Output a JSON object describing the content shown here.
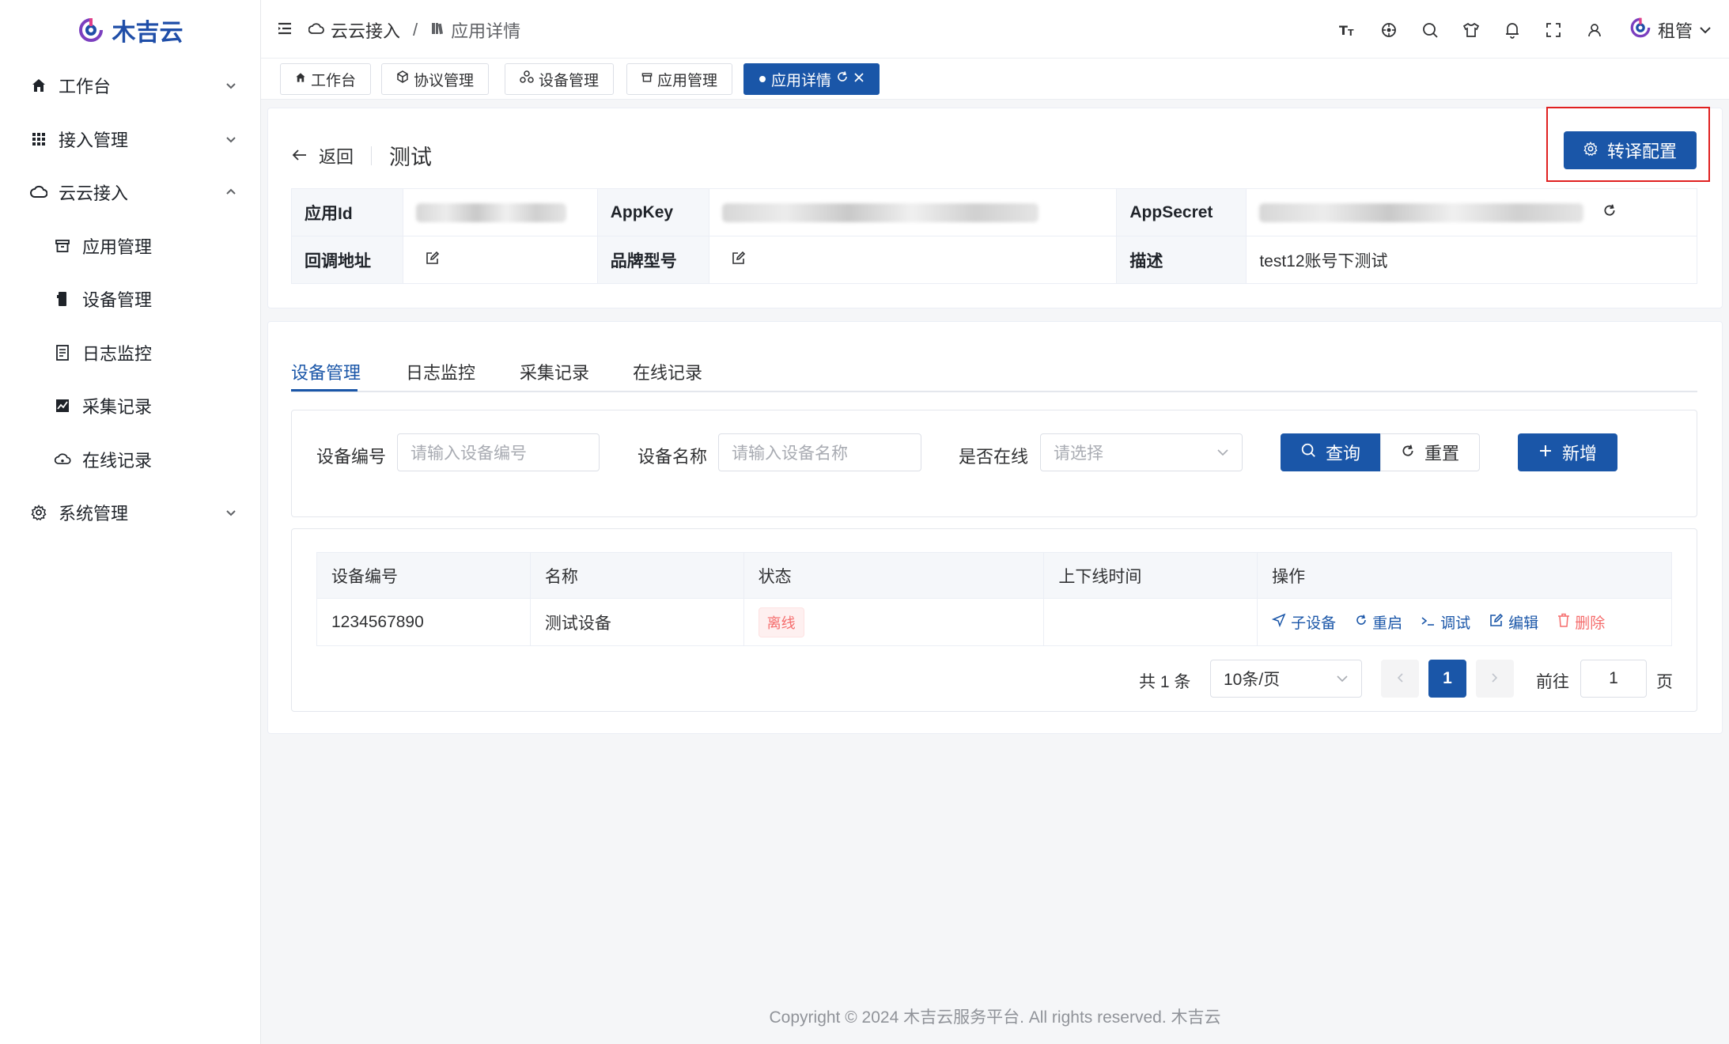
{
  "app": {
    "brand": "木吉云",
    "brand_color": "#1f4ea8",
    "accent": "#1a56a8",
    "danger": "#f56c6c"
  },
  "sidebar": {
    "items": [
      {
        "label": "工作台",
        "icon": "home-icon",
        "chevron": "down"
      },
      {
        "label": "接入管理",
        "icon": "grid-icon",
        "chevron": "down"
      },
      {
        "label": "云云接入",
        "icon": "cloud-icon",
        "chevron": "up"
      },
      {
        "label": "应用管理",
        "icon": "archive-icon"
      },
      {
        "label": "设备管理",
        "icon": "device-icon"
      },
      {
        "label": "日志监控",
        "icon": "document-icon"
      },
      {
        "label": "采集记录",
        "icon": "chart-icon"
      },
      {
        "label": "在线记录",
        "icon": "cloud-sync-icon"
      },
      {
        "label": "系统管理",
        "icon": "gear-icon",
        "chevron": "down"
      }
    ]
  },
  "header": {
    "breadcrumb": [
      "云云接入",
      "应用详情"
    ],
    "separator": "/",
    "user": "租管",
    "icons": [
      "font-size-icon",
      "locate-icon",
      "search-icon",
      "theme-shirt-icon",
      "bell-icon",
      "fullscreen-icon",
      "user-icon"
    ]
  },
  "tags": [
    {
      "label": "工作台"
    },
    {
      "label": "协议管理"
    },
    {
      "label": "设备管理"
    },
    {
      "label": "应用管理"
    },
    {
      "label": "应用详情",
      "active": true
    }
  ],
  "detail": {
    "back": "返回",
    "title": "测试",
    "translate_button": "转译配置",
    "rows": [
      {
        "k1": "应用Id",
        "k2": "AppKey",
        "k3": "AppSecret"
      },
      {
        "k1": "回调地址",
        "k2": "品牌型号",
        "k3": "描述",
        "v3": "test12账号下测试"
      }
    ]
  },
  "tabs": [
    "设备管理",
    "日志监控",
    "采集记录",
    "在线记录"
  ],
  "search": {
    "code_label": "设备编号",
    "code_placeholder": "请输入设备编号",
    "name_label": "设备名称",
    "name_placeholder": "请输入设备名称",
    "online_label": "是否在线",
    "online_placeholder": "请选择",
    "query": "查询",
    "reset": "重置",
    "add": "新增"
  },
  "table": {
    "headers": [
      "设备编号",
      "名称",
      "状态",
      "上下线时间",
      "操作"
    ],
    "rows": [
      {
        "code": "1234567890",
        "name": "测试设备",
        "status": "离线",
        "time": ""
      }
    ],
    "ops": [
      "子设备",
      "重启",
      "调试",
      "编辑",
      "删除"
    ]
  },
  "pagination": {
    "total": "共 1 条",
    "page_size": "10条/页",
    "current": "1",
    "goto_label": "前往",
    "goto_value": "1",
    "page_unit": "页"
  },
  "footer": "Copyright © 2024 木吉云服务平台. All rights reserved. 木吉云"
}
